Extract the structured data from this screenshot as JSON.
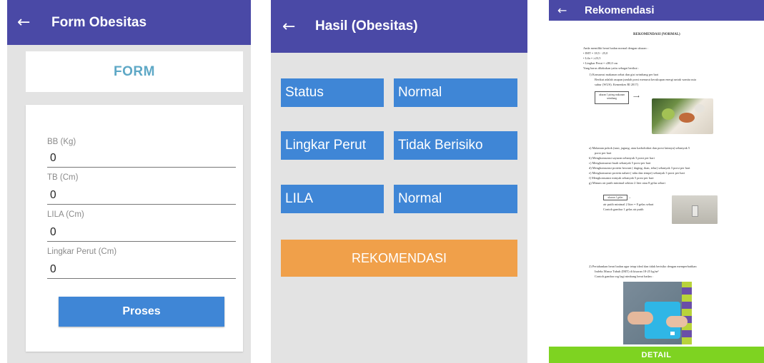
{
  "form": {
    "title": "Form Obesitas",
    "card_title": "FORM",
    "fields": [
      {
        "label": "BB (Kg)",
        "value": "0"
      },
      {
        "label": "TB (Cm)",
        "value": "0"
      },
      {
        "label": "LILA (Cm)",
        "value": "0"
      },
      {
        "label": "Lingkar Perut (Cm)",
        "value": "0"
      }
    ],
    "submit_label": "Proses"
  },
  "hasil": {
    "title": "Hasil (Obesitas)",
    "rows": [
      {
        "label": "Status",
        "value": "Normal"
      },
      {
        "label": "Lingkar Perut",
        "value": "Tidak Berisiko"
      },
      {
        "label": "LILA",
        "value": "Normal"
      }
    ],
    "button_label": "REKOMENDASI"
  },
  "rekomendasi": {
    "title": "Rekomendasi",
    "doc_heading": "REKOMENDASI (NORMAL)",
    "intro": "Anda memiliki berat badan normal dengan ukuran :",
    "bullets": [
      "IMT = 18,5 - 25,0",
      "Lila = ≥23,5",
      "Lingkar Perut = ≤80,0 cm"
    ],
    "todo": "Yang harus dilakukan yaitu sebagai berikut :",
    "item1": "1) Konsumsi makanan sehat dan gizi seimbang per hari",
    "item1_desc1": "Berikut adalah asupan jumlah porsi menurut kecukupan energi untuk wanita usia",
    "item1_desc2": "subur (WUS). Kemenkes RI 2017)",
    "box_label": "ukuran 1 piring makanan seimbang",
    "sub_items": [
      "a) Makanan pokok (nasi, jagung, atau karbohidrat dan porsi lainnya) sebanyak 5",
      "porsi per hari",
      "b) Mengkonsumsi sayuran sebanyak 3 porsi per hari",
      "c) Mengkonsumsi buah sebanyak 5 porsi per hari",
      "d) Mengkonsumsi protein hewani ( daging, ikan, telur) sebanyak 3 porsi per hari",
      "e) Mengkonsumsi protein nabati ( tahu dan tempe) sebanyak 3 porsi per hari",
      "f) Mengkonsumsi minyak sebanyak 5 porsi per hari",
      "g) Minum air putih minimal sekitar 2 liter atau 8 gelas sehari"
    ],
    "glass_box": "ukuran 1 gelas",
    "glass_text1": "air putih minimal 2 liter = 8 gelas sehari",
    "glass_text2": "Contoh gambar 1 gelas air putih",
    "item2_1": "2) Pertahankan berat badan agar tetap ideal dan tidak berisiko dengan memperhatikan",
    "item2_2": "Indeks Massa Tubuh (IMT) di kisaran 18-25 kg/m²",
    "item2_3": "Contoh gambar org lagi nimbang berat badan :",
    "button_label": "DETAIL"
  },
  "colors": {
    "appbar": "#4a49a6",
    "blue_button": "#3f86d6",
    "orange_button": "#f0a04a",
    "green_button": "#7ed321",
    "form_title_color": "#5ea8c6"
  },
  "icons": [
    "arrow-back-icon"
  ]
}
